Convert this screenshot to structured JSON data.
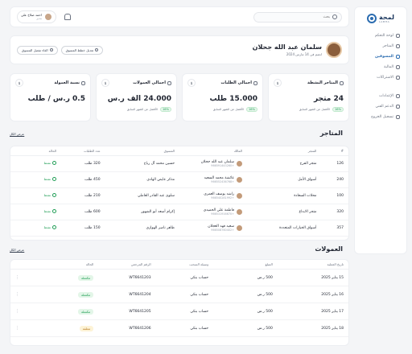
{
  "brand": {
    "name": "لمحة",
    "sub": "LAMHA"
  },
  "sidebar": {
    "items": [
      {
        "label": "لوحة التحكم",
        "icon": "dashboard-icon",
        "active": false
      },
      {
        "label": "المتاجر",
        "icon": "store-icon",
        "active": false
      },
      {
        "label": "المسوقين",
        "icon": "users-icon",
        "active": true
      },
      {
        "label": "المالية",
        "icon": "wallet-icon",
        "active": false
      },
      {
        "label": "الاشتراكات",
        "icon": "subscription-icon",
        "active": false
      }
    ],
    "bottom": [
      {
        "label": "الإعدادات",
        "icon": "gear-icon"
      },
      {
        "label": "الدعم الفني",
        "icon": "support-icon"
      },
      {
        "label": "تسجيل الخروج",
        "icon": "logout-icon"
      }
    ]
  },
  "header": {
    "search_placeholder": "بحث",
    "user_name": "احمد صلاح علي",
    "user_role": "مدير"
  },
  "profile": {
    "name": "سلمان عبد الله جحلان",
    "date": "انضم في 14 مارس 2024",
    "edit_button": "تعديل خطط المسوق",
    "disable_button": "الغاء تفعيل المسوق"
  },
  "stats": [
    {
      "title": "المتاجر النشطة",
      "icon": "store-icon",
      "badge": "$",
      "value": "24 متجر",
      "change": "16%",
      "note": "الأفضل عن الشهر السابق"
    },
    {
      "title": "اجمالي الطلبات",
      "icon": "bag-icon",
      "badge": "$",
      "value": "15.000 طلب",
      "change": "16%",
      "note": "الأفضل عن الشهر السابق"
    },
    {
      "title": "اجمالي العمولات",
      "icon": "coin-icon",
      "badge": "$",
      "value": "24.000 الف ر.س",
      "change": "16%",
      "note": "الأفضل عن الشهر السابق"
    },
    {
      "title": "نسبة العمولة",
      "icon": "percent-icon",
      "badge": "$",
      "value": "0.5 ر.س / طلب",
      "change": "",
      "note": ""
    }
  ],
  "stores_section": {
    "title": "المتاجر",
    "show_all": "عرض الكل",
    "columns": [
      "#",
      "المتجر",
      "المالك",
      "المسوق",
      "عدد الطلبات",
      "الحالة"
    ],
    "rows": [
      {
        "id": "126",
        "store": "متجر الفرح",
        "owner": "سلمان عبد الله جحلان",
        "phone": "+966591443260",
        "marketer": "حسين محمد آل رباح",
        "orders": "320 طلب",
        "status": "نشط"
      },
      {
        "id": "240",
        "store": "أسواق الأمل",
        "owner": "عائشة محمد السعيد",
        "phone": "+966552436768",
        "marketer": "مذكر عايض الهادي",
        "orders": "450 طلب",
        "status": "نشط"
      },
      {
        "id": "100",
        "store": "محلات السعادة",
        "owner": "راشد يوسف العمري",
        "phone": "+966540281992",
        "marketer": "سلوى عبد القادر العاملي",
        "orders": "210 طلب",
        "status": "نشط"
      },
      {
        "id": "320",
        "store": "متجر الابداع",
        "owner": "فاطمة علي الحميدي",
        "phone": "+966531916670",
        "marketer": "إكرام أسعد أبو الشهور",
        "orders": "600 طلب",
        "status": "نشط"
      },
      {
        "id": "357",
        "store": "أسواق الخيارات المتعددة",
        "owner": "سعيد فهد العجلان",
        "phone": "+966508760402",
        "marketer": "طاهر ناصر الهوازي",
        "orders": "150 طلب",
        "status": "نشط"
      }
    ]
  },
  "commissions_section": {
    "title": "العمولات",
    "show_all": "عرض الكل",
    "columns": [
      "تاريخ العملية",
      "المبلغ",
      "وسيلة السحب",
      "الرقم المرجعي",
      "الحالة",
      ""
    ],
    "rows": [
      {
        "date": "15 يناير 2025",
        "amount": "500 ر.س",
        "method": "حساب بنكي",
        "ref": "WT6641203",
        "status": "مكتملة",
        "tone": "green"
      },
      {
        "date": "16 يناير 2025",
        "amount": "500 ر.س",
        "method": "حساب بنكي",
        "ref": "WT6641204",
        "status": "مكتملة",
        "tone": "green"
      },
      {
        "date": "17 يناير 2025",
        "amount": "500 ر.س",
        "method": "حساب بنكي",
        "ref": "WT6641205",
        "status": "مكتملة",
        "tone": "green"
      },
      {
        "date": "18 يناير 2025",
        "amount": "500 ر.س",
        "method": "حساب بنكي",
        "ref": "WT6641206",
        "status": "معلقة",
        "tone": "yellow"
      }
    ]
  },
  "colors": {
    "accent": "#2b6cb0",
    "success": "#1f9d55",
    "pending": "#b7791f"
  }
}
